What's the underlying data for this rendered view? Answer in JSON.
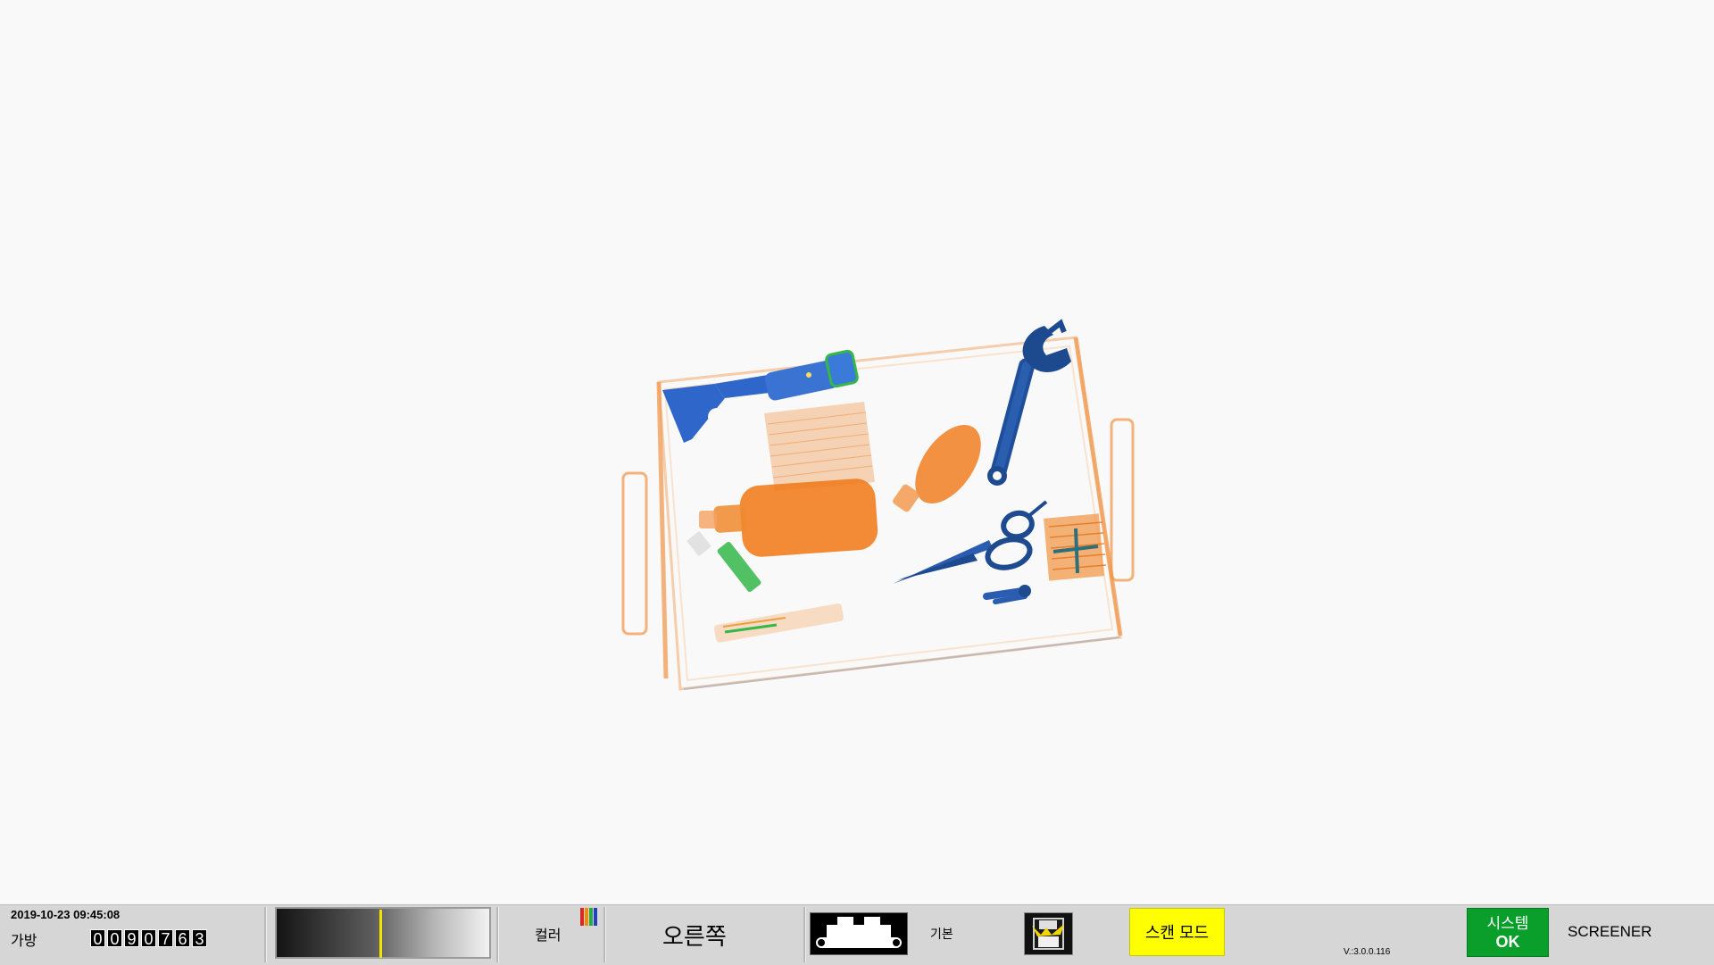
{
  "status_bar": {
    "datetime": "2019-10-23 09:45:08",
    "bag_label": "가방",
    "bag_counter_digits": [
      "0",
      "0",
      "9",
      "0",
      "7",
      "6",
      "3"
    ],
    "gray_level": 0.49,
    "color_label": "컬러",
    "color_icon_colors": [
      "#d62828",
      "#f08c00",
      "#2aa84a",
      "#2040c0"
    ],
    "orientation_label": "오른쪽",
    "basic_label": "기본",
    "scan_mode_label": "스캔 모드",
    "version": "V.:3.0.0.116",
    "system_title": "시스템",
    "system_value": "OK",
    "screener_label": "SCREENER"
  },
  "colors": {
    "scan_mode_bg": "#ffff00",
    "system_ok_bg": "#0a9e2a",
    "organic": "#f07a1a",
    "metal": "#2f66c9",
    "inorganic": "#35b74a"
  },
  "xray_items": [
    "scraper-tool",
    "adjustable-wrench",
    "scissors",
    "bottle",
    "small-bottle",
    "lighter",
    "zipper-pulls",
    "box-container"
  ]
}
